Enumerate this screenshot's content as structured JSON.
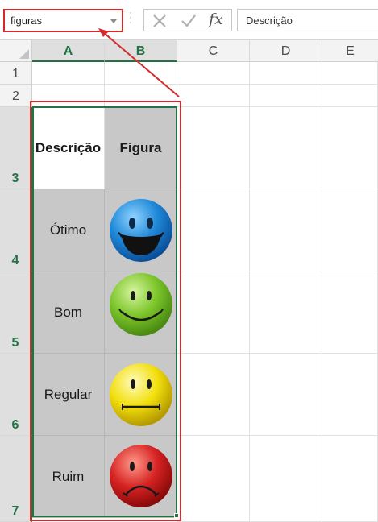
{
  "name_box": {
    "value": "figuras"
  },
  "formula_bar": {
    "fx_label": "fx",
    "value": "Descrição"
  },
  "columns": [
    "A",
    "B",
    "C",
    "D",
    "E"
  ],
  "rows": [
    "1",
    "2",
    "3",
    "4",
    "5",
    "6",
    "7"
  ],
  "table": {
    "headers": {
      "descricao": "Descrição",
      "figura": "Figura"
    },
    "items": [
      {
        "label": "Ótimo",
        "face": "very-happy-smiley",
        "color": "#1e88d8"
      },
      {
        "label": "Bom",
        "face": "happy-smiley",
        "color": "#7cc52a"
      },
      {
        "label": "Regular",
        "face": "neutral-smiley",
        "color": "#f2df0c"
      },
      {
        "label": "Ruim",
        "face": "sad-smiley",
        "color": "#d62222"
      }
    ]
  },
  "colors": {
    "selection": "#217346",
    "highlight": "#d42a2a",
    "cell_fill": "#c8c8c8"
  }
}
